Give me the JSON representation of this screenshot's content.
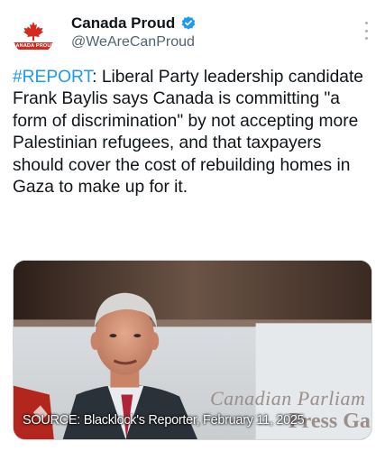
{
  "account": {
    "display_name": "Canada Proud",
    "handle": "@WeAreCanProud",
    "avatar_banner": "CANADA PROUD",
    "verified_icon": "verified-badge-icon",
    "more_icon": "more-options-icon"
  },
  "tweet": {
    "hashtag": "#REPORT",
    "body": ": Liberal Party leadership candidate Frank Baylis says Canada is committing \"a form of discrimination\" by not accepting more Palestinian refugees, and that taxpayers should cover the cost of rebuilding homes in Gaza to make up for it."
  },
  "media": {
    "caption": "SOURCE: Blacklock's Reporter, February 11, 2025",
    "wall_text_line1": "Canadian Parliam",
    "wall_text_line2": "Press Ga"
  },
  "colors": {
    "accent": "#1d9bf0",
    "text": "#0f1419",
    "secondary": "#536471",
    "brand_red": "#d52b1e"
  }
}
